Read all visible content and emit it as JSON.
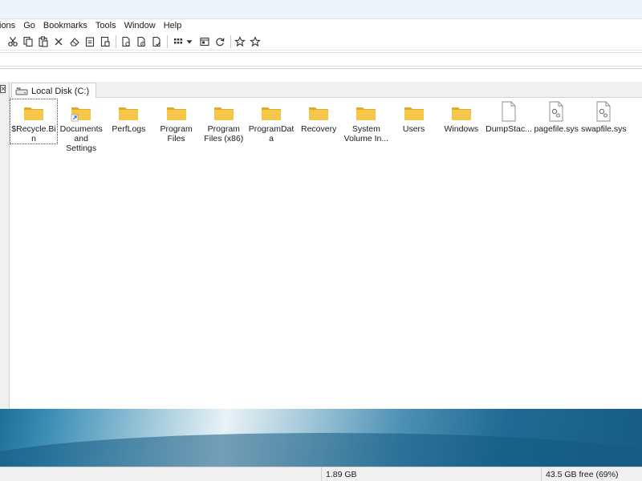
{
  "menubar": {
    "items": [
      "ions",
      "Go",
      "Bookmarks",
      "Tools",
      "Window",
      "Help"
    ]
  },
  "toolbar": {
    "icons": [
      "cut-icon",
      "copy-icon",
      "paste-icon",
      "delete-icon",
      "eraser-icon",
      "clipboard-icon",
      "file-paste-icon",
      "page-icon",
      "page-gear-icon",
      "page-check-icon",
      "grid-view-icon",
      "dropdown-arrow-icon",
      "panel-icon",
      "refresh-icon",
      "star-add-icon",
      "star-icon"
    ]
  },
  "tab": {
    "label": "Local Disk (C:)",
    "close_glyph": "×"
  },
  "files": [
    {
      "name": "$Recycle.Bin",
      "type": "folder"
    },
    {
      "name": "Documents and Settings",
      "type": "folder-shortcut"
    },
    {
      "name": "PerfLogs",
      "type": "folder"
    },
    {
      "name": "Program Files",
      "type": "folder"
    },
    {
      "name": "Program Files (x86)",
      "type": "folder"
    },
    {
      "name": "ProgramData",
      "type": "folder"
    },
    {
      "name": "Recovery",
      "type": "folder"
    },
    {
      "name": "System Volume In...",
      "type": "folder"
    },
    {
      "name": "Users",
      "type": "folder"
    },
    {
      "name": "Windows",
      "type": "folder"
    },
    {
      "name": "DumpStac...",
      "type": "file"
    },
    {
      "name": "pagefile.sys",
      "type": "system-file"
    },
    {
      "name": "swapfile.sys",
      "type": "system-file"
    }
  ],
  "status": {
    "size": "1.89 GB",
    "free": "43.5 GB free (69%)"
  },
  "colors": {
    "folder": "#f4c64a",
    "folder_dark": "#e3a923",
    "shortcut_arrow": "#1e6fd0"
  }
}
